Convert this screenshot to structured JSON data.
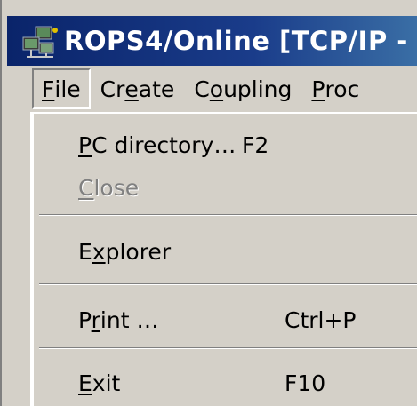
{
  "window": {
    "title": "ROPS4/Online [TCP/IP -"
  },
  "menubar": {
    "items": [
      {
        "label": "File",
        "accel_index": 0,
        "active": true
      },
      {
        "label": "Create",
        "accel_index": 2,
        "active": false
      },
      {
        "label": "Coupling",
        "accel_index": 1,
        "active": false
      },
      {
        "label": "Proc",
        "accel_index": 0,
        "active": false
      }
    ]
  },
  "file_menu": {
    "items": [
      {
        "label": "PC directory…",
        "shortcut": "F2",
        "enabled": true
      },
      {
        "label": "Close",
        "shortcut": "",
        "enabled": false
      },
      {
        "label": "Explorer",
        "shortcut": "",
        "enabled": true
      },
      {
        "label": "Print …",
        "shortcut": "Ctrl+P",
        "enabled": true
      },
      {
        "label": "Exit",
        "shortcut": "F10",
        "enabled": true
      }
    ]
  },
  "icons": {
    "app": "network-computer-icon"
  },
  "colors": {
    "titlebar_start": "#0a246a",
    "titlebar_end": "#3a6ea5",
    "face": "#d4d0c8",
    "disabled_text": "#808080"
  }
}
